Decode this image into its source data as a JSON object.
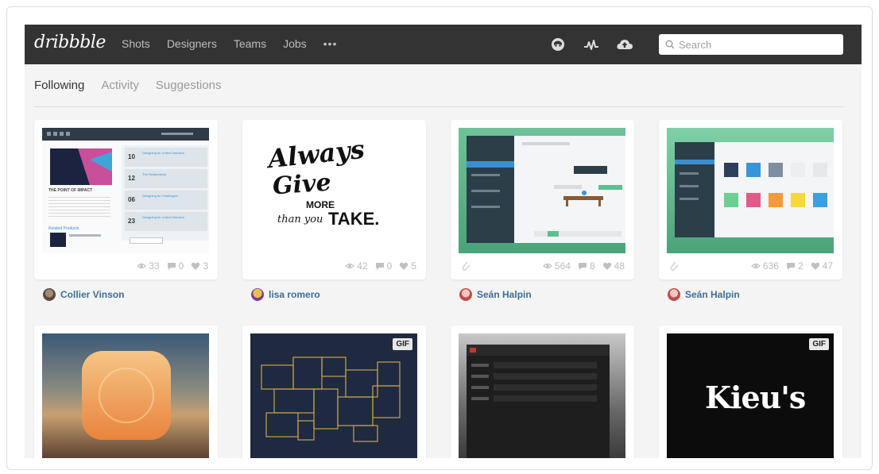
{
  "app": {
    "logo": "dribbble"
  },
  "nav": {
    "links": [
      "Shots",
      "Designers",
      "Teams",
      "Jobs"
    ],
    "more": "•••",
    "icons": [
      "avatar-face-icon",
      "activity-pulse-icon",
      "cloud-upload-icon"
    ]
  },
  "search": {
    "placeholder": "Search"
  },
  "subtabs": [
    "Following",
    "Activity",
    "Suggestions"
  ],
  "shots": [
    {
      "author": "Collier Vinson",
      "views": "33",
      "comments": "0",
      "likes": "3",
      "thumb": "website-layout",
      "row_cards": [
        "Designing for a New Direction",
        "The Relationship",
        "Designing for Challenges",
        "Designing for a New Direction"
      ],
      "side_numbers": [
        "10",
        "12",
        "06",
        "23"
      ],
      "page_heading": "THE POINT OF IMPACT",
      "section_heading": "Related Products"
    },
    {
      "author": "lisa romero",
      "views": "42",
      "comments": "0",
      "likes": "5",
      "thumb": "lettering",
      "lettering": {
        "line1": "Always",
        "line2": "Give",
        "line3": "MORE",
        "line4": "than you",
        "line5": "TAKE."
      }
    },
    {
      "author": "Seán Halpin",
      "views": "564",
      "comments": "8",
      "likes": "48",
      "thumb": "green-app",
      "attachment": true
    },
    {
      "author": "Seán Halpin",
      "views": "636",
      "comments": "2",
      "likes": "47",
      "thumb": "green-palette",
      "attachment": true
    },
    {
      "thumb": "orange-icon"
    },
    {
      "thumb": "floorplan",
      "badge": "GIF"
    },
    {
      "thumb": "dark-ui"
    },
    {
      "thumb": "kieus-logo",
      "badge": "GIF",
      "wordmark": "Kieu's"
    }
  ]
}
